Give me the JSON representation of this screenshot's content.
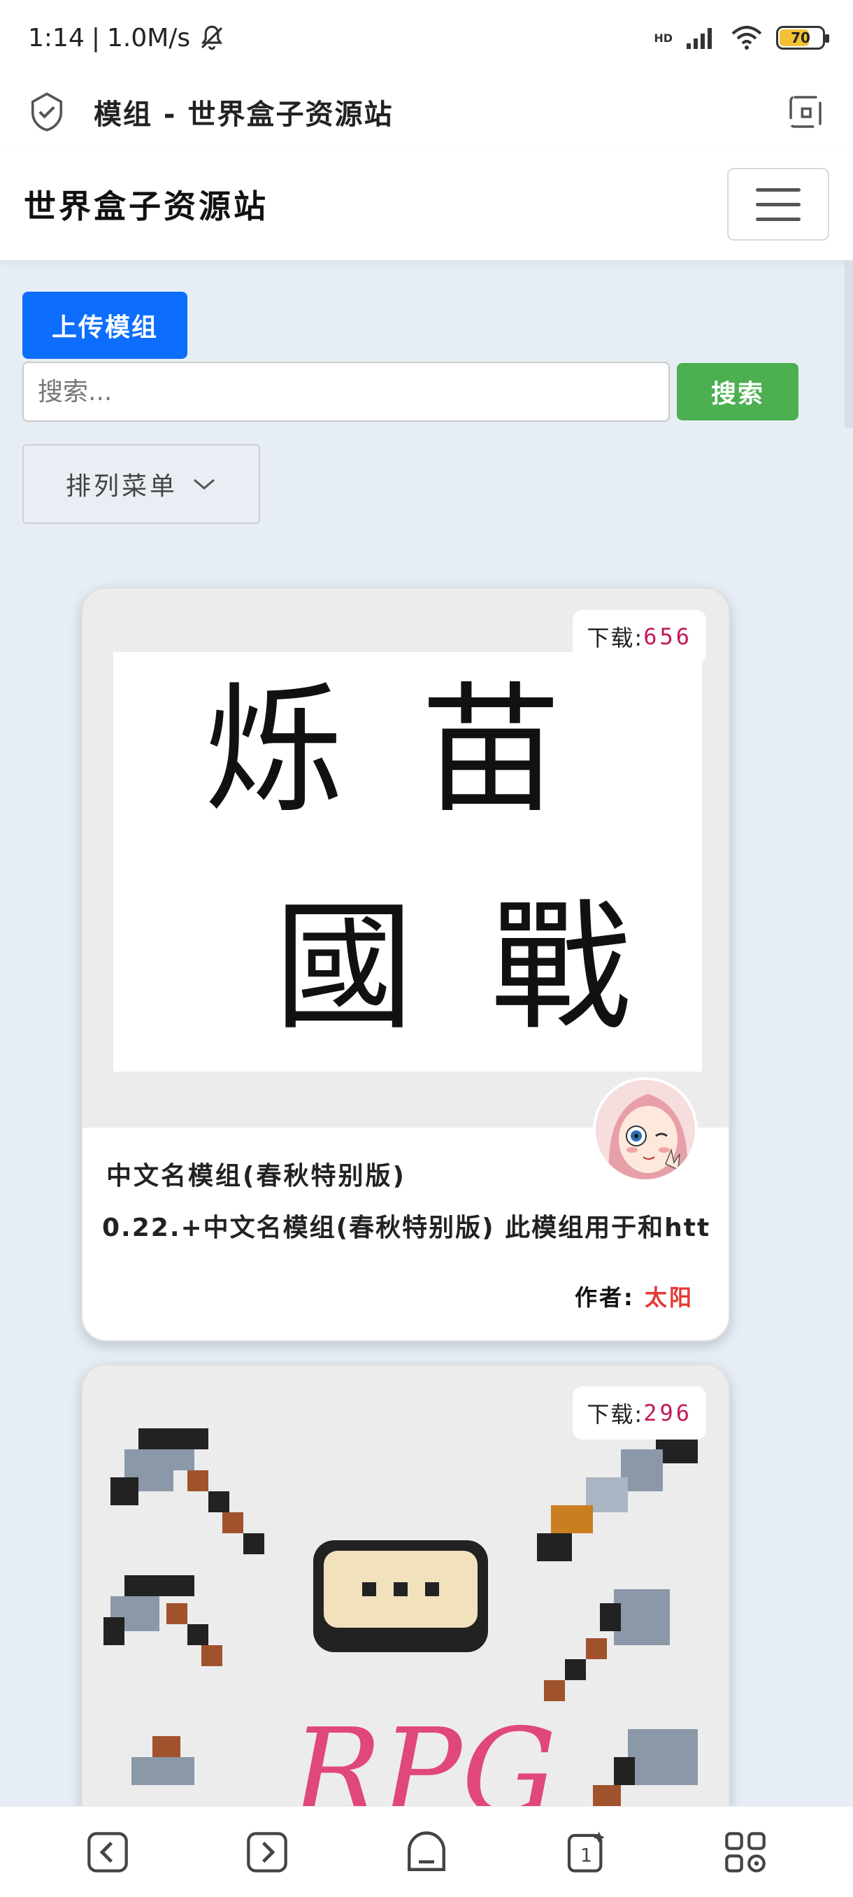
{
  "status_bar": {
    "time": "1:14",
    "speed": "1.0M/s",
    "battery": "70",
    "battery_level": 0.7,
    "battery_color": "#f3c234",
    "network": "HD"
  },
  "browser": {
    "title": "模组 - 世界盒子资源站"
  },
  "navbar": {
    "brand": "世界盒子资源站"
  },
  "controls": {
    "upload_label": "上传模组",
    "search_placeholder": "搜索...",
    "search_label": "搜索",
    "sort_label": "排列菜单"
  },
  "cards": [
    {
      "downloads_label": "下载:",
      "downloads": "656",
      "title": "中文名模组(春秋特别版)",
      "description": "0.22.+中文名模组(春秋特别版) 此模组用于和htt",
      "author_label": "作者:",
      "author": "太阳",
      "image_text": [
        "烁",
        "苗",
        "國",
        "戰"
      ]
    },
    {
      "downloads_label": "下载:",
      "downloads": "296",
      "image_text": [
        "RPG"
      ]
    }
  ],
  "colors": {
    "primary": "#0d6efd",
    "success": "#4caf50",
    "author": "#e53935",
    "downloads": "#c2185b",
    "page_bg": "#e6edf5"
  },
  "icons": {
    "shield": "shield-check-icon",
    "rotate": "rotate-screen-icon",
    "menu": "hamburger-menu-icon",
    "chevron": "chevron-down-icon",
    "back": "back-icon",
    "forward": "forward-icon",
    "home": "home-icon",
    "tabs": "tabs-icon",
    "apps": "apps-icon"
  }
}
